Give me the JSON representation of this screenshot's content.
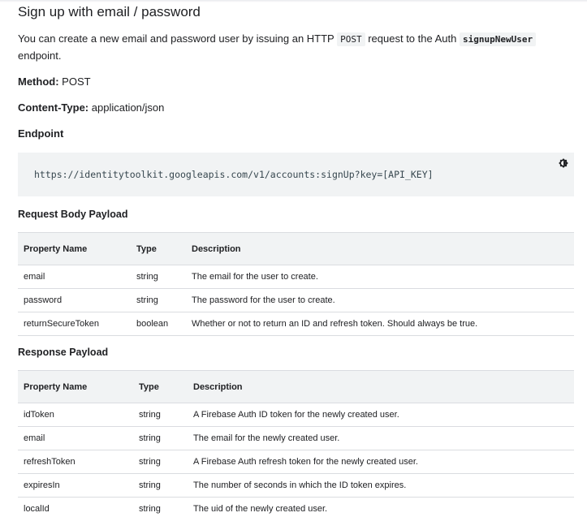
{
  "title": "Sign up with email / password",
  "intro": {
    "before": "You can create a new email and password user by issuing an HTTP ",
    "code1": "POST",
    "middle": " request to the Auth ",
    "code2": "signupNewUser",
    "after": " endpoint."
  },
  "method": {
    "label": "Method:",
    "value": " POST"
  },
  "content_type": {
    "label": "Content-Type:",
    "value": " application/json"
  },
  "endpoint": {
    "heading": "Endpoint",
    "url": "https://identitytoolkit.googleapis.com/v1/accounts:signUp?key=[API_KEY]",
    "theme_icon": "brightness-icon"
  },
  "request": {
    "heading": "Request Body Payload",
    "columns": [
      "Property Name",
      "Type",
      "Description"
    ],
    "rows": [
      [
        "email",
        "string",
        "The email for the user to create."
      ],
      [
        "password",
        "string",
        "The password for the user to create."
      ],
      [
        "returnSecureToken",
        "boolean",
        "Whether or not to return an ID and refresh token. Should always be true."
      ]
    ]
  },
  "response": {
    "heading": "Response Payload",
    "columns": [
      "Property Name",
      "Type",
      "Description"
    ],
    "rows": [
      [
        "idToken",
        "string",
        "A Firebase Auth ID token for the newly created user."
      ],
      [
        "email",
        "string",
        "The email for the newly created user."
      ],
      [
        "refreshToken",
        "string",
        "A Firebase Auth refresh token for the newly created user."
      ],
      [
        "expiresIn",
        "string",
        "The number of seconds in which the ID token expires."
      ],
      [
        "localId",
        "string",
        "The uid of the newly created user."
      ]
    ]
  }
}
